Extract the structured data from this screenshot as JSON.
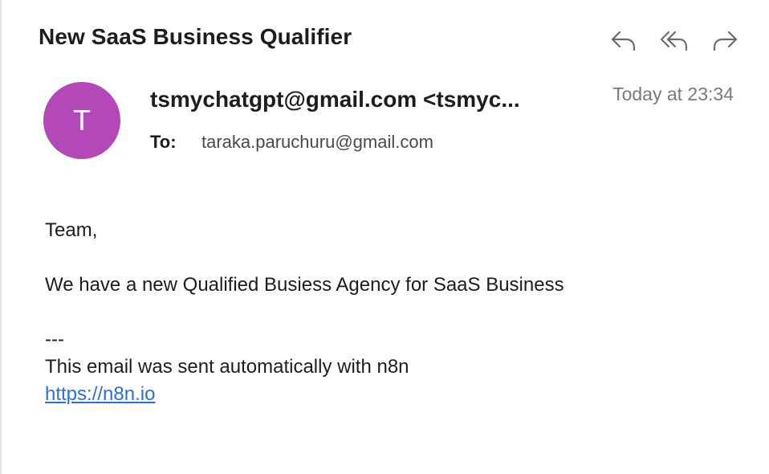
{
  "email": {
    "subject": "New SaaS Business Qualifier",
    "sender_initial": "T",
    "sender": "tsmychatgpt@gmail.com <tsmyc...",
    "timestamp": "Today at 23:34",
    "to_label": "To:",
    "to_value": "taraka.paruchuru@gmail.com",
    "body": {
      "greeting": "Team,",
      "message": "We have a new Qualified Busiess Agency for SaaS Business",
      "separator": "---",
      "footer": "This email was sent automatically with n8n",
      "link": "https://n8n.io"
    }
  },
  "toolbar": {
    "icons": [
      "reply-icon",
      "reply-all-icon",
      "forward-icon"
    ]
  },
  "colors": {
    "avatar": "#b548b8",
    "link": "#2a6fdb",
    "timestamp": "#7a7a7e"
  }
}
